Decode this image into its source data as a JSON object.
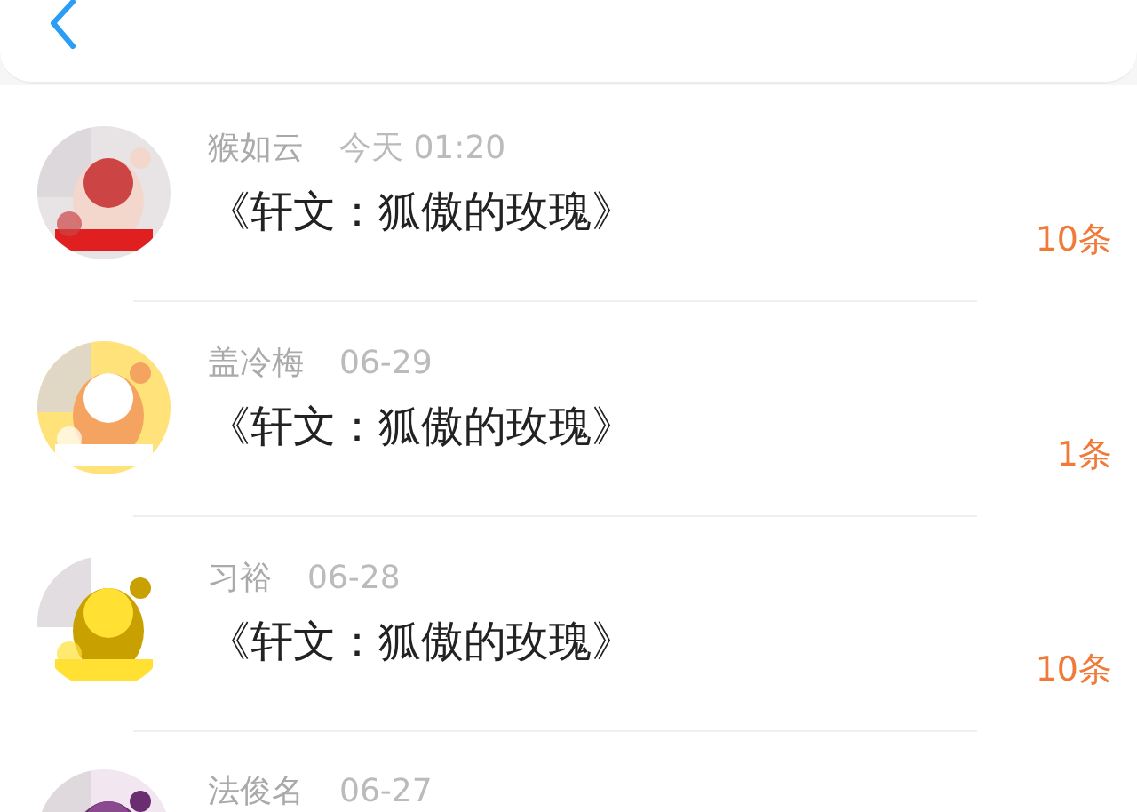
{
  "messages": [
    {
      "name": "猴如云",
      "time": "今天 01:20",
      "title": "《轩文：狐傲的玫瑰》",
      "count": "10条"
    },
    {
      "name": "盖冷梅",
      "time": "06-29",
      "title": "《轩文：狐傲的玫瑰》",
      "count": "1条"
    },
    {
      "name": "习裕",
      "time": "06-28",
      "title": "《轩文：狐傲的玫瑰》",
      "count": "10条"
    },
    {
      "name": "法俊名",
      "time": "06-27"
    }
  ]
}
